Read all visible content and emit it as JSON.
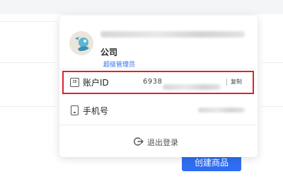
{
  "background": {
    "create_button_label": "创建商品"
  },
  "profile": {
    "company": "公司",
    "role_badge": "超级管理员"
  },
  "account_row": {
    "label": "账户ID",
    "id_prefix": "6938",
    "copy_label": "复制",
    "icon": "id-card-icon"
  },
  "phone_row": {
    "label": "手机号",
    "icon": "phone-icon"
  },
  "logout": {
    "label": "退出登录",
    "icon": "logout-icon"
  },
  "colors": {
    "accent": "#2f6df2",
    "highlight": "#d9242e"
  }
}
